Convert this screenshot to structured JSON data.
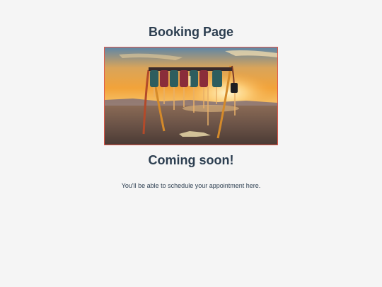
{
  "page": {
    "title": "Booking Page",
    "subtitle": "Coming soon!",
    "message": "You'll be able to schedule your appointment here."
  },
  "hero_image": {
    "description_icon": "swing-set-sunset-image",
    "border_color": "#e0574a"
  }
}
